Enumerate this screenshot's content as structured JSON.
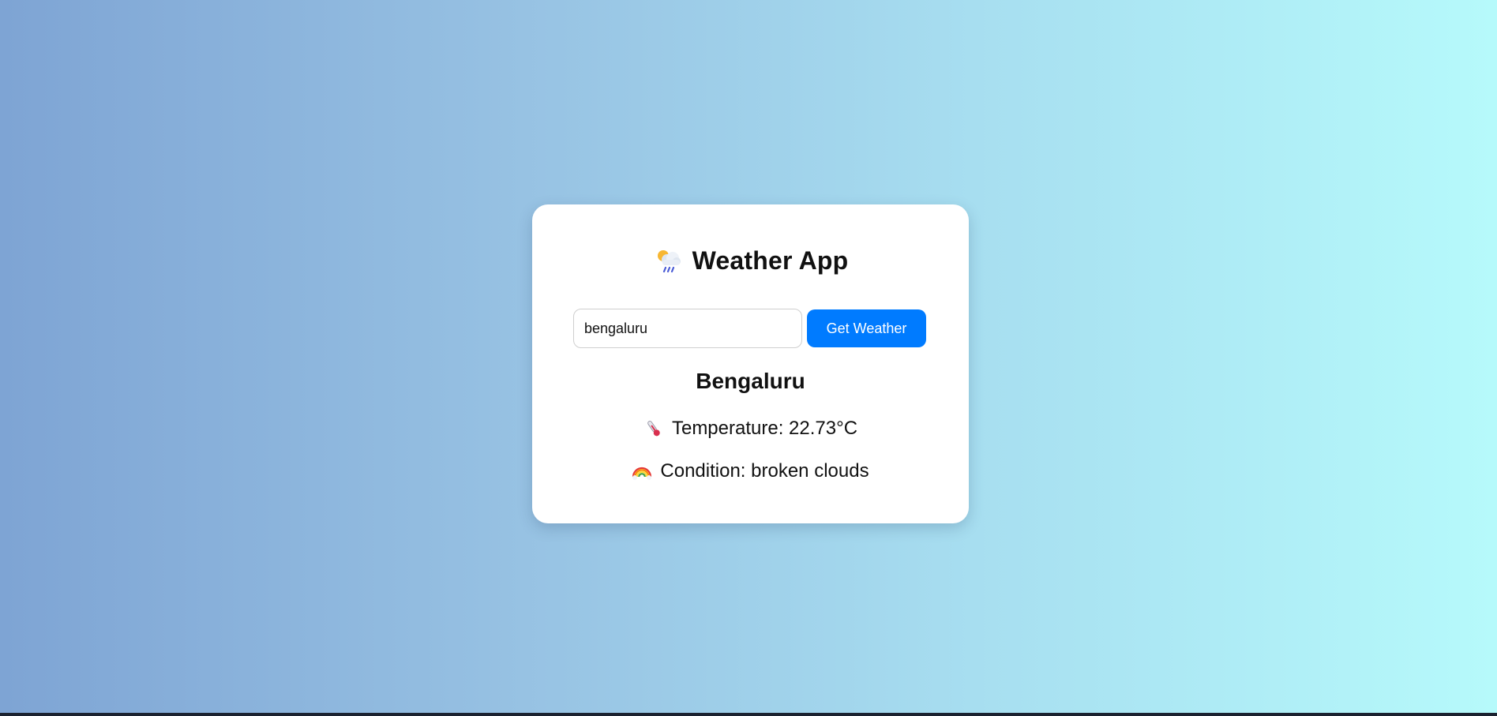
{
  "app": {
    "title": "Weather App",
    "title_icon": "cloud-sun-rain-icon"
  },
  "search": {
    "value": "bengaluru",
    "button_label": "Get Weather"
  },
  "result": {
    "city": "Bengaluru",
    "temperature_text": "Temperature: 22.73°C",
    "temperature_icon": "thermometer-icon",
    "condition_text": "Condition: broken clouds",
    "condition_icon": "rainbow-icon"
  },
  "colors": {
    "accent": "#007bff",
    "card_bg": "#ffffff",
    "gradient_start": "#7ea4d4",
    "gradient_end": "#b6fafb"
  }
}
